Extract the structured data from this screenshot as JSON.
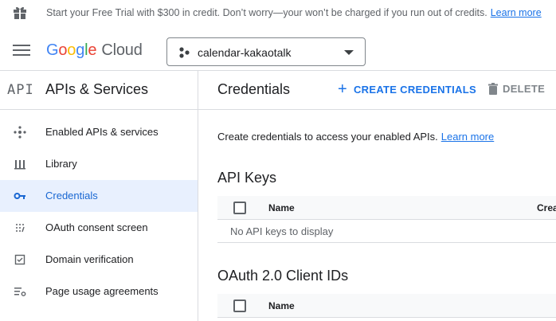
{
  "banner": {
    "message": "Start your Free Trial with $300 in credit. Don’t worry—your won’t be charged if you run out of credits.",
    "link": "Learn more"
  },
  "topbar": {
    "logo_google": [
      "G",
      "o",
      "o",
      "g",
      "l",
      "e"
    ],
    "logo_product": "Cloud",
    "project_name": "calendar-kakaotalk"
  },
  "section": {
    "icon_text": "API",
    "title": "APIs & Services"
  },
  "sidebar": {
    "items": [
      {
        "label": "Enabled APIs & services",
        "icon": "hub-icon"
      },
      {
        "label": "Library",
        "icon": "library-icon"
      },
      {
        "label": "Credentials",
        "icon": "key-icon",
        "active": true
      },
      {
        "label": "OAuth consent screen",
        "icon": "consent-icon"
      },
      {
        "label": "Domain verification",
        "icon": "checkbox-icon"
      },
      {
        "label": "Page usage agreements",
        "icon": "settings-list-icon"
      }
    ]
  },
  "header": {
    "page_title": "Credentials",
    "create_label": "CREATE CREDENTIALS",
    "delete_label": "DELETE"
  },
  "main": {
    "intro_text": "Create credentials to access your enabled APIs.",
    "intro_link": "Learn more",
    "api_keys": {
      "title": "API Keys",
      "columns": [
        "Name",
        "Crea"
      ],
      "empty_text": "No API keys to display"
    },
    "oauth": {
      "title": "OAuth 2.0 Client IDs",
      "columns": [
        "Name"
      ]
    }
  },
  "colors": {
    "accent": "#1a73e8",
    "active_bg": "#e8f0fe",
    "divider": "#dadce0"
  }
}
